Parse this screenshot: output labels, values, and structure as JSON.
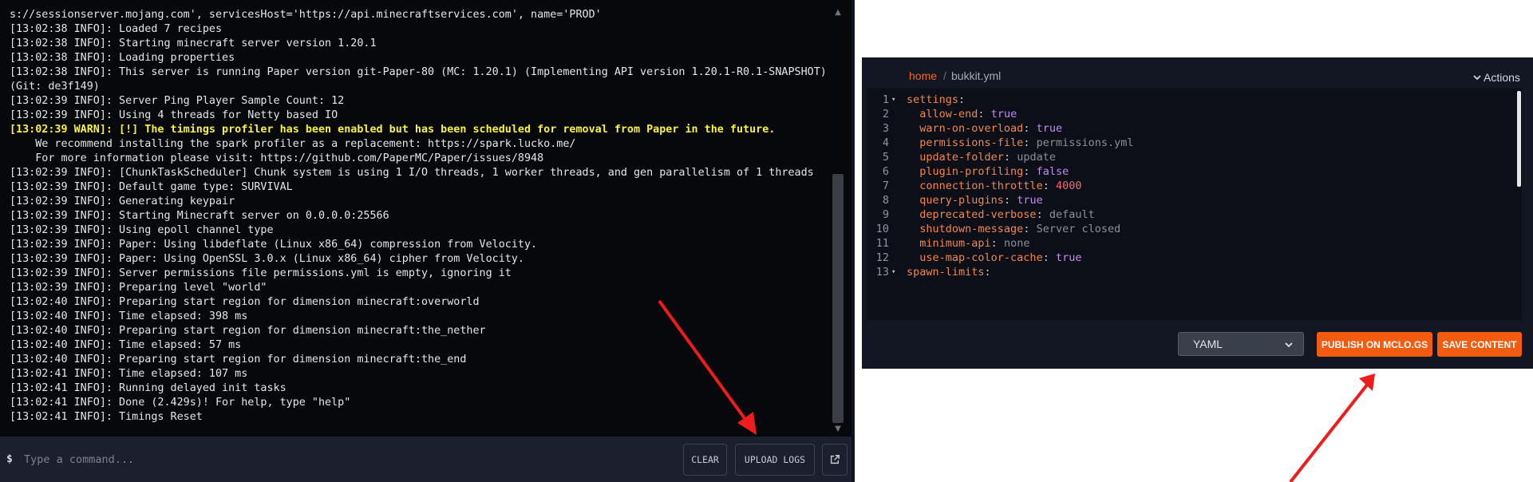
{
  "console": {
    "log_lines": [
      {
        "text": "s://sessionserver.mojang.com', servicesHost='https://api.minecraftservices.com', name='PROD'",
        "level": "info"
      },
      {
        "text": "[13:02:38 INFO]: Loaded 7 recipes",
        "level": "info"
      },
      {
        "text": "[13:02:38 INFO]: Starting minecraft server version 1.20.1",
        "level": "info"
      },
      {
        "text": "[13:02:38 INFO]: Loading properties",
        "level": "info"
      },
      {
        "text": "[13:02:38 INFO]: This server is running Paper version git-Paper-80 (MC: 1.20.1) (Implementing API version 1.20.1-R0.1-SNAPSHOT)",
        "level": "info"
      },
      {
        "text": "(Git: de3f149)",
        "level": "info"
      },
      {
        "text": "[13:02:39 INFO]: Server Ping Player Sample Count: 12",
        "level": "info"
      },
      {
        "text": "[13:02:39 INFO]: Using 4 threads for Netty based IO",
        "level": "info"
      },
      {
        "text": "[13:02:39 WARN]: [!] The timings profiler has been enabled but has been scheduled for removal from Paper in the future.",
        "level": "warn"
      },
      {
        "text": "    We recommend installing the spark profiler as a replacement: https://spark.lucko.me/",
        "level": "info"
      },
      {
        "text": "    For more information please visit: https://github.com/PaperMC/Paper/issues/8948",
        "level": "info"
      },
      {
        "text": "[13:02:39 INFO]: [ChunkTaskScheduler] Chunk system is using 1 I/O threads, 1 worker threads, and gen parallelism of 1 threads",
        "level": "info"
      },
      {
        "text": "[13:02:39 INFO]: Default game type: SURVIVAL",
        "level": "info"
      },
      {
        "text": "[13:02:39 INFO]: Generating keypair",
        "level": "info"
      },
      {
        "text": "[13:02:39 INFO]: Starting Minecraft server on 0.0.0.0:25566",
        "level": "info"
      },
      {
        "text": "[13:02:39 INFO]: Using epoll channel type",
        "level": "info"
      },
      {
        "text": "[13:02:39 INFO]: Paper: Using libdeflate (Linux x86_64) compression from Velocity.",
        "level": "info"
      },
      {
        "text": "[13:02:39 INFO]: Paper: Using OpenSSL 3.0.x (Linux x86_64) cipher from Velocity.",
        "level": "info"
      },
      {
        "text": "[13:02:39 INFO]: Server permissions file permissions.yml is empty, ignoring it",
        "level": "info"
      },
      {
        "text": "[13:02:39 INFO]: Preparing level \"world\"",
        "level": "info"
      },
      {
        "text": "[13:02:40 INFO]: Preparing start region for dimension minecraft:overworld",
        "level": "info"
      },
      {
        "text": "[13:02:40 INFO]: Time elapsed: 398 ms",
        "level": "info"
      },
      {
        "text": "[13:02:40 INFO]: Preparing start region for dimension minecraft:the_nether",
        "level": "info"
      },
      {
        "text": "[13:02:40 INFO]: Time elapsed: 57 ms",
        "level": "info"
      },
      {
        "text": "[13:02:40 INFO]: Preparing start region for dimension minecraft:the_end",
        "level": "info"
      },
      {
        "text": "[13:02:41 INFO]: Time elapsed: 107 ms",
        "level": "info"
      },
      {
        "text": "[13:02:41 INFO]: Running delayed init tasks",
        "level": "info"
      },
      {
        "text": "[13:02:41 INFO]: Done (2.429s)! For help, type \"help\"",
        "level": "info"
      },
      {
        "text": "[13:02:41 INFO]: Timings Reset",
        "level": "info"
      }
    ],
    "prompt_symbol": "$",
    "command_placeholder": "Type a command...",
    "command_value": "",
    "clear_label": "CLEAR",
    "upload_label": "UPLOAD LOGS",
    "external_icon": "external-link-icon",
    "colors": {
      "background": "#07080c",
      "text": "#e3e6ea",
      "warn": "#f8f140",
      "cmdbar": "#1b1f2e"
    }
  },
  "editor": {
    "breadcrumb_home": "home",
    "breadcrumb_sep": "/",
    "file_name": "bukkit.yml",
    "actions_label": "Actions",
    "actions_icon": "chevron-down-icon",
    "lines": [
      {
        "num": "1",
        "fold": "▾",
        "indent": "",
        "key": "settings",
        "value": "",
        "vtype": ""
      },
      {
        "num": "2",
        "fold": "",
        "indent": "  ",
        "key": "allow-end",
        "value": "true",
        "vtype": "bool"
      },
      {
        "num": "3",
        "fold": "",
        "indent": "  ",
        "key": "warn-on-overload",
        "value": "true",
        "vtype": "bool"
      },
      {
        "num": "4",
        "fold": "",
        "indent": "  ",
        "key": "permissions-file",
        "value": "permissions.yml",
        "vtype": "str"
      },
      {
        "num": "5",
        "fold": "",
        "indent": "  ",
        "key": "update-folder",
        "value": "update",
        "vtype": "str"
      },
      {
        "num": "6",
        "fold": "",
        "indent": "  ",
        "key": "plugin-profiling",
        "value": "false",
        "vtype": "bool"
      },
      {
        "num": "7",
        "fold": "",
        "indent": "  ",
        "key": "connection-throttle",
        "value": "4000",
        "vtype": "num"
      },
      {
        "num": "8",
        "fold": "",
        "indent": "  ",
        "key": "query-plugins",
        "value": "true",
        "vtype": "bool"
      },
      {
        "num": "9",
        "fold": "",
        "indent": "  ",
        "key": "deprecated-verbose",
        "value": "default",
        "vtype": "str"
      },
      {
        "num": "10",
        "fold": "",
        "indent": "  ",
        "key": "shutdown-message",
        "value": "Server closed",
        "vtype": "str"
      },
      {
        "num": "11",
        "fold": "",
        "indent": "  ",
        "key": "minimum-api",
        "value": "none",
        "vtype": "str"
      },
      {
        "num": "12",
        "fold": "",
        "indent": "  ",
        "key": "use-map-color-cache",
        "value": "true",
        "vtype": "bool"
      },
      {
        "num": "13",
        "fold": "▾",
        "indent": "",
        "key": "spawn-limits",
        "value": "",
        "vtype": ""
      }
    ],
    "language": "YAML",
    "publish_label": "PUBLISH ON MCLO.GS",
    "save_label": "SAVE CONTENT",
    "colors": {
      "background": "#131623",
      "code_bg": "#0d0f18",
      "key": "#f0874e",
      "bool": "#c28af2",
      "num": "#f06a6a",
      "str": "#8a8f98",
      "accent": "#f35c10",
      "breadcrumb": "#ec6a2c"
    }
  },
  "annotations": {
    "arrow_color": "#ee1c1c"
  }
}
